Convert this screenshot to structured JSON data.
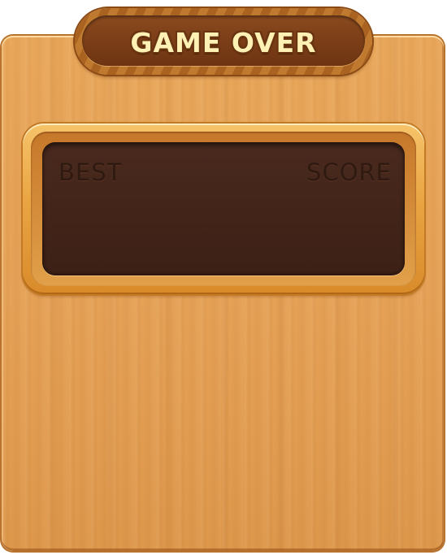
{
  "title": "GAME OVER",
  "score_panel": {
    "best_label": "BEST",
    "score_label": "SCORE"
  },
  "colors": {
    "wood_board": "#e6a257",
    "plaque_stripe_light": "#c07a30",
    "plaque_stripe_dark": "#a9621f",
    "plaque_inner": "#7a3d17",
    "title_text": "#fff0b3",
    "frame_gold": "#eaa543",
    "panel_dark": "#422419",
    "label_text": "#2f1a12"
  }
}
